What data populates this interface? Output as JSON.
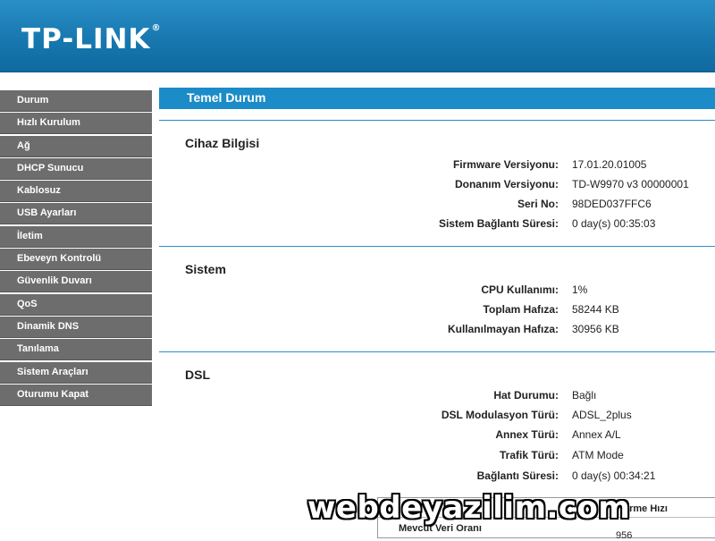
{
  "header": {
    "brand": "TP-LINK",
    "brand_mark": "®"
  },
  "sidebar": {
    "items": [
      {
        "label": "Durum"
      },
      {
        "label": "Hızlı Kurulum"
      },
      {
        "label": "Ağ"
      },
      {
        "label": "DHCP Sunucu"
      },
      {
        "label": "Kablosuz"
      },
      {
        "label": "USB Ayarları"
      },
      {
        "label": "İletim"
      },
      {
        "label": "Ebeveyn Kontrolü"
      },
      {
        "label": "Güvenlik Duvarı"
      },
      {
        "label": "QoS"
      },
      {
        "label": "Dinamik DNS"
      },
      {
        "label": "Tanılama"
      },
      {
        "label": "Sistem Araçları"
      },
      {
        "label": "Oturumu Kapat"
      }
    ]
  },
  "main": {
    "title": "Temel Durum",
    "device": {
      "title": "Cihaz Bilgisi",
      "firmware_label": "Firmware Versiyonu:",
      "firmware_value": "17.01.20.01005",
      "hardware_label": "Donanım Versiyonu:",
      "hardware_value": "TD-W9970 v3 00000001",
      "serial_label": "Seri No:",
      "serial_value": "98DED037FFC6",
      "uptime_label": "Sistem Bağlantı Süresi:",
      "uptime_value": "0 day(s) 00:35:03"
    },
    "system": {
      "title": "Sistem",
      "cpu_label": "CPU Kullanımı:",
      "cpu_value": "1%",
      "total_mem_label": "Toplam Hafıza:",
      "total_mem_value": "58244 KB",
      "free_mem_label": "Kullanılmayan Hafıza:",
      "free_mem_value": "30956 KB"
    },
    "dsl": {
      "title": "DSL",
      "line_label": "Hat Durumu:",
      "line_value": "Bağlı",
      "modulation_label": "DSL Modulasyon Türü:",
      "modulation_value": "ADSL_2plus",
      "annex_label": "Annex Türü:",
      "annex_value": "Annex A/L",
      "traffic_label": "Trafik Türü:",
      "traffic_value": "ATM Mode",
      "conn_time_label": "Bağlantı Süresi:",
      "conn_time_value": "0 day(s) 00:34:21",
      "table_header_partial": "erme Hızı",
      "table_row_label": "Mevcut Veri Oranı",
      "table_value_partial": "956"
    }
  },
  "watermark": {
    "text": "webdeyazilim.com"
  }
}
